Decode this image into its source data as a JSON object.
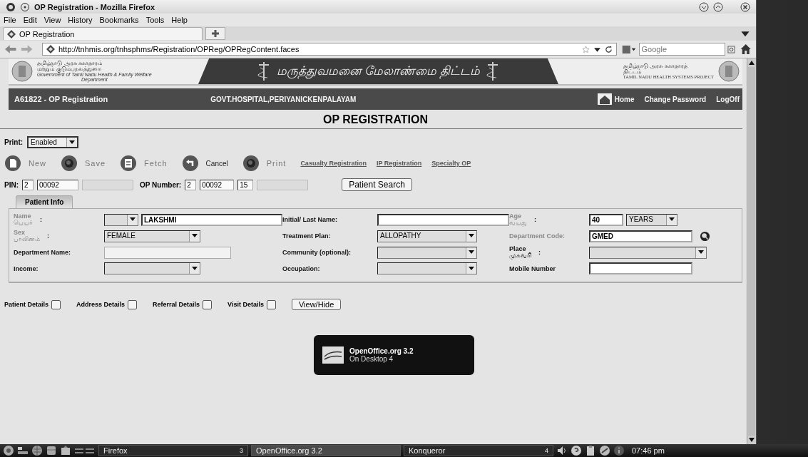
{
  "window": {
    "title": "OP Registration - Mozilla Firefox"
  },
  "menu": [
    "File",
    "Edit",
    "View",
    "History",
    "Bookmarks",
    "Tools",
    "Help"
  ],
  "browser_tab": {
    "label": "OP Registration",
    "selected": true
  },
  "address_bar": {
    "url": "http://tnhmis.org/tnhsphms/Registration/OPReg/OPRegContent.faces"
  },
  "search_bar": {
    "placeholder": "Google"
  },
  "banner": {
    "left_tamil_1": "தமிழ்நாடு அரசு சுகாதாரம்",
    "left_tamil_2": "மற்றும் குடும்பநலத்துறை",
    "left_english": "Government of Tamil Nadu Health & Family Welfare",
    "left_english_2": "Department",
    "center_tamil": "மருத்துவமனை மேலாண்மை திட்டம்",
    "right_tamil_1": "தமிழ்நாடு அரசு சுகாதாரத்",
    "right_tamil_2": "திட்டம்",
    "right_english": "TAMIL NADU HEALTH SYSTEMS PROJECT"
  },
  "header": {
    "user": "A61822 - OP Registration",
    "hospital": "GOVT.HOSPITAL,PERIYANICKENPALAYAM",
    "links": [
      "Home",
      "Change Password",
      "LogOff"
    ]
  },
  "page_title": "OP REGISTRATION",
  "print_select": {
    "label": "Print:",
    "value": "Enabled"
  },
  "actions": [
    {
      "label": "New",
      "kind": "page"
    },
    {
      "label": "Save",
      "kind": "disc"
    },
    {
      "label": "Fetch",
      "kind": "fetch"
    },
    {
      "label": "Cancel",
      "kind": "undo"
    },
    {
      "label": "Print",
      "kind": "disc"
    }
  ],
  "links": [
    "Casualty Registration",
    "IP Registration",
    "Specialty OP"
  ],
  "pin": {
    "label": "PIN:",
    "fields": [
      {
        "kind": "filled",
        "value": "2"
      },
      {
        "kind": "filled",
        "value": "00092"
      },
      {
        "kind": "blank"
      }
    ]
  },
  "op_number": {
    "label": "OP Number:",
    "fields": [
      {
        "kind": "filled",
        "value": "2"
      },
      {
        "kind": "filled",
        "value": "00092"
      },
      {
        "kind": "filled",
        "value": "15"
      },
      {
        "kind": "blank"
      }
    ]
  },
  "patient_search_button": "Patient Search",
  "form_tabs": [
    {
      "label": "Patient Info",
      "selected": true
    }
  ],
  "fields": [
    {
      "label": "Name",
      "label_tamil": "பெயர்",
      "colon": ":",
      "dimmed": true,
      "kind": "prefix-text",
      "value": "LAKSHMI"
    },
    {
      "label": "Initial/ Last Name:",
      "dimmed": false,
      "kind": "text"
    },
    {
      "label": "Age",
      "label_tamil": "வயது",
      "colon": ":",
      "dimmed": true,
      "kind": "number-unit",
      "value": "40",
      "unit": "YEARS"
    },
    {
      "label": "Sex",
      "label_tamil": "பாலினம்",
      "colon": ":",
      "dimmed": true,
      "kind": "select",
      "value": "FEMALE"
    },
    {
      "label": "Treatment Plan:",
      "dimmed": false,
      "kind": "select",
      "value": "ALLOPATHY"
    },
    {
      "label": "Department Code:",
      "dimmed": true,
      "kind": "lookup",
      "value": "GMED"
    },
    {
      "label": "Department Name:",
      "dimmed": false,
      "kind": "readonly"
    },
    {
      "label": "Community (optional):",
      "dimmed": false,
      "kind": "select"
    },
    {
      "label": "Place",
      "label_tamil": "முகவரி",
      "colon": ":",
      "dimmed": false,
      "kind": "select"
    },
    {
      "label": "Income:",
      "dimmed": false,
      "kind": "select"
    },
    {
      "label": "Occupation:",
      "dimmed": false,
      "kind": "select"
    },
    {
      "label": "Mobile Number",
      "dimmed": false,
      "kind": "text"
    }
  ],
  "detail_toggles": [
    {
      "label": "Patient Details",
      "checked": false
    },
    {
      "label": "Address Details",
      "checked": false
    },
    {
      "label": "Referral Details",
      "checked": false
    },
    {
      "label": "Visit Details",
      "checked": false
    }
  ],
  "view_hide_button": "View/Hide",
  "notification": {
    "title": "OpenOffice.org 3.2",
    "subtitle": "On Desktop 4"
  },
  "taskbar": {
    "tasks": [
      {
        "label": "Firefox",
        "desktop": "3",
        "selected": false
      },
      {
        "label": "OpenOffice.org 3.2",
        "selected": true
      },
      {
        "label": "Konqueror",
        "desktop": "4",
        "selected": false
      }
    ],
    "clock": "07:46 pm"
  }
}
